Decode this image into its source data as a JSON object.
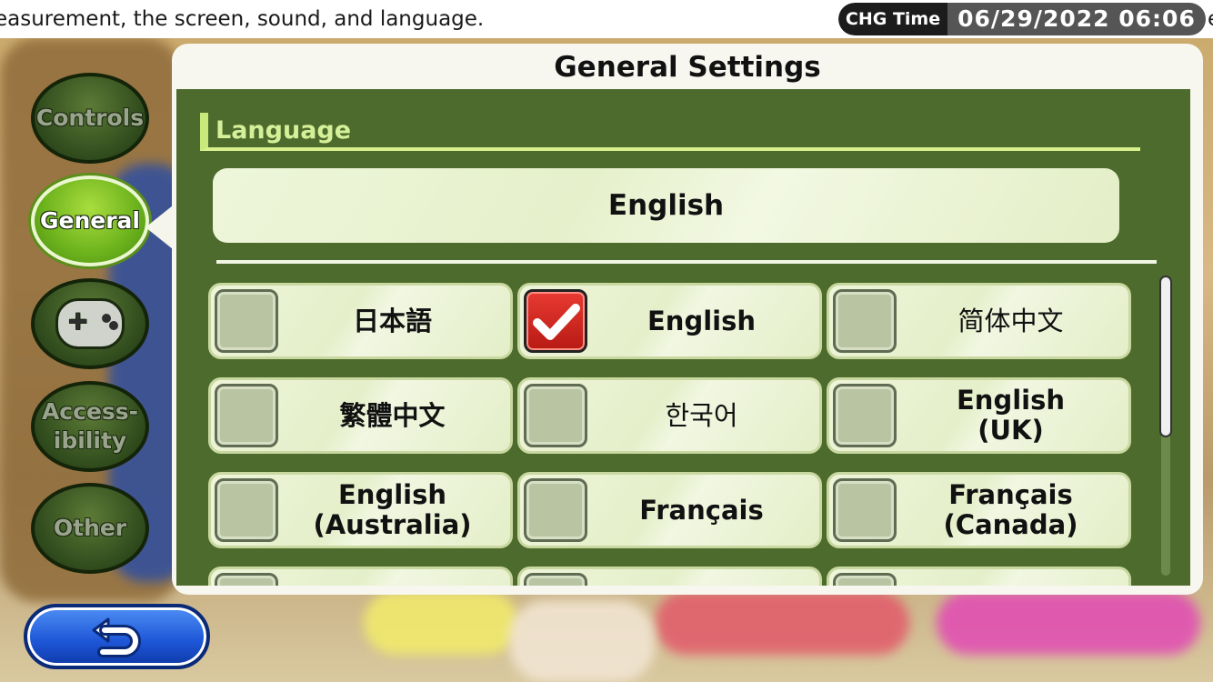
{
  "ticker": {
    "text": "easurement, the screen, sound, and language.",
    "tail": "e"
  },
  "time": {
    "label": "CHG Time",
    "value": "06/29/2022 06:06"
  },
  "nav": {
    "items": [
      {
        "label": "Controls",
        "active": false
      },
      {
        "label": "General",
        "active": true
      },
      {
        "label": "",
        "icon": "gamepad-icon",
        "active": false
      },
      {
        "label": "Access-\nibility",
        "active": false
      },
      {
        "label": "Other",
        "active": false
      }
    ]
  },
  "panel": {
    "title": "General Settings",
    "section": "Language",
    "current": "English"
  },
  "options": [
    {
      "label": "日本語",
      "checked": false
    },
    {
      "label": "English",
      "checked": true
    },
    {
      "label": "简体中文",
      "checked": false
    },
    {
      "label": "繁體中文",
      "checked": false
    },
    {
      "label": "한국어",
      "checked": false
    },
    {
      "label": "English\n(UK)",
      "checked": false
    },
    {
      "label": "English\n(Australia)",
      "checked": false
    },
    {
      "label": "Français",
      "checked": false
    },
    {
      "label": "Français\n(Canada)",
      "checked": false
    }
  ],
  "icons": {
    "back": "back-arrow-icon",
    "check": "checkmark-icon"
  },
  "colors": {
    "accent": "#6cb21c",
    "panel_green": "#4d6b2c",
    "check_red": "#d1261d"
  }
}
